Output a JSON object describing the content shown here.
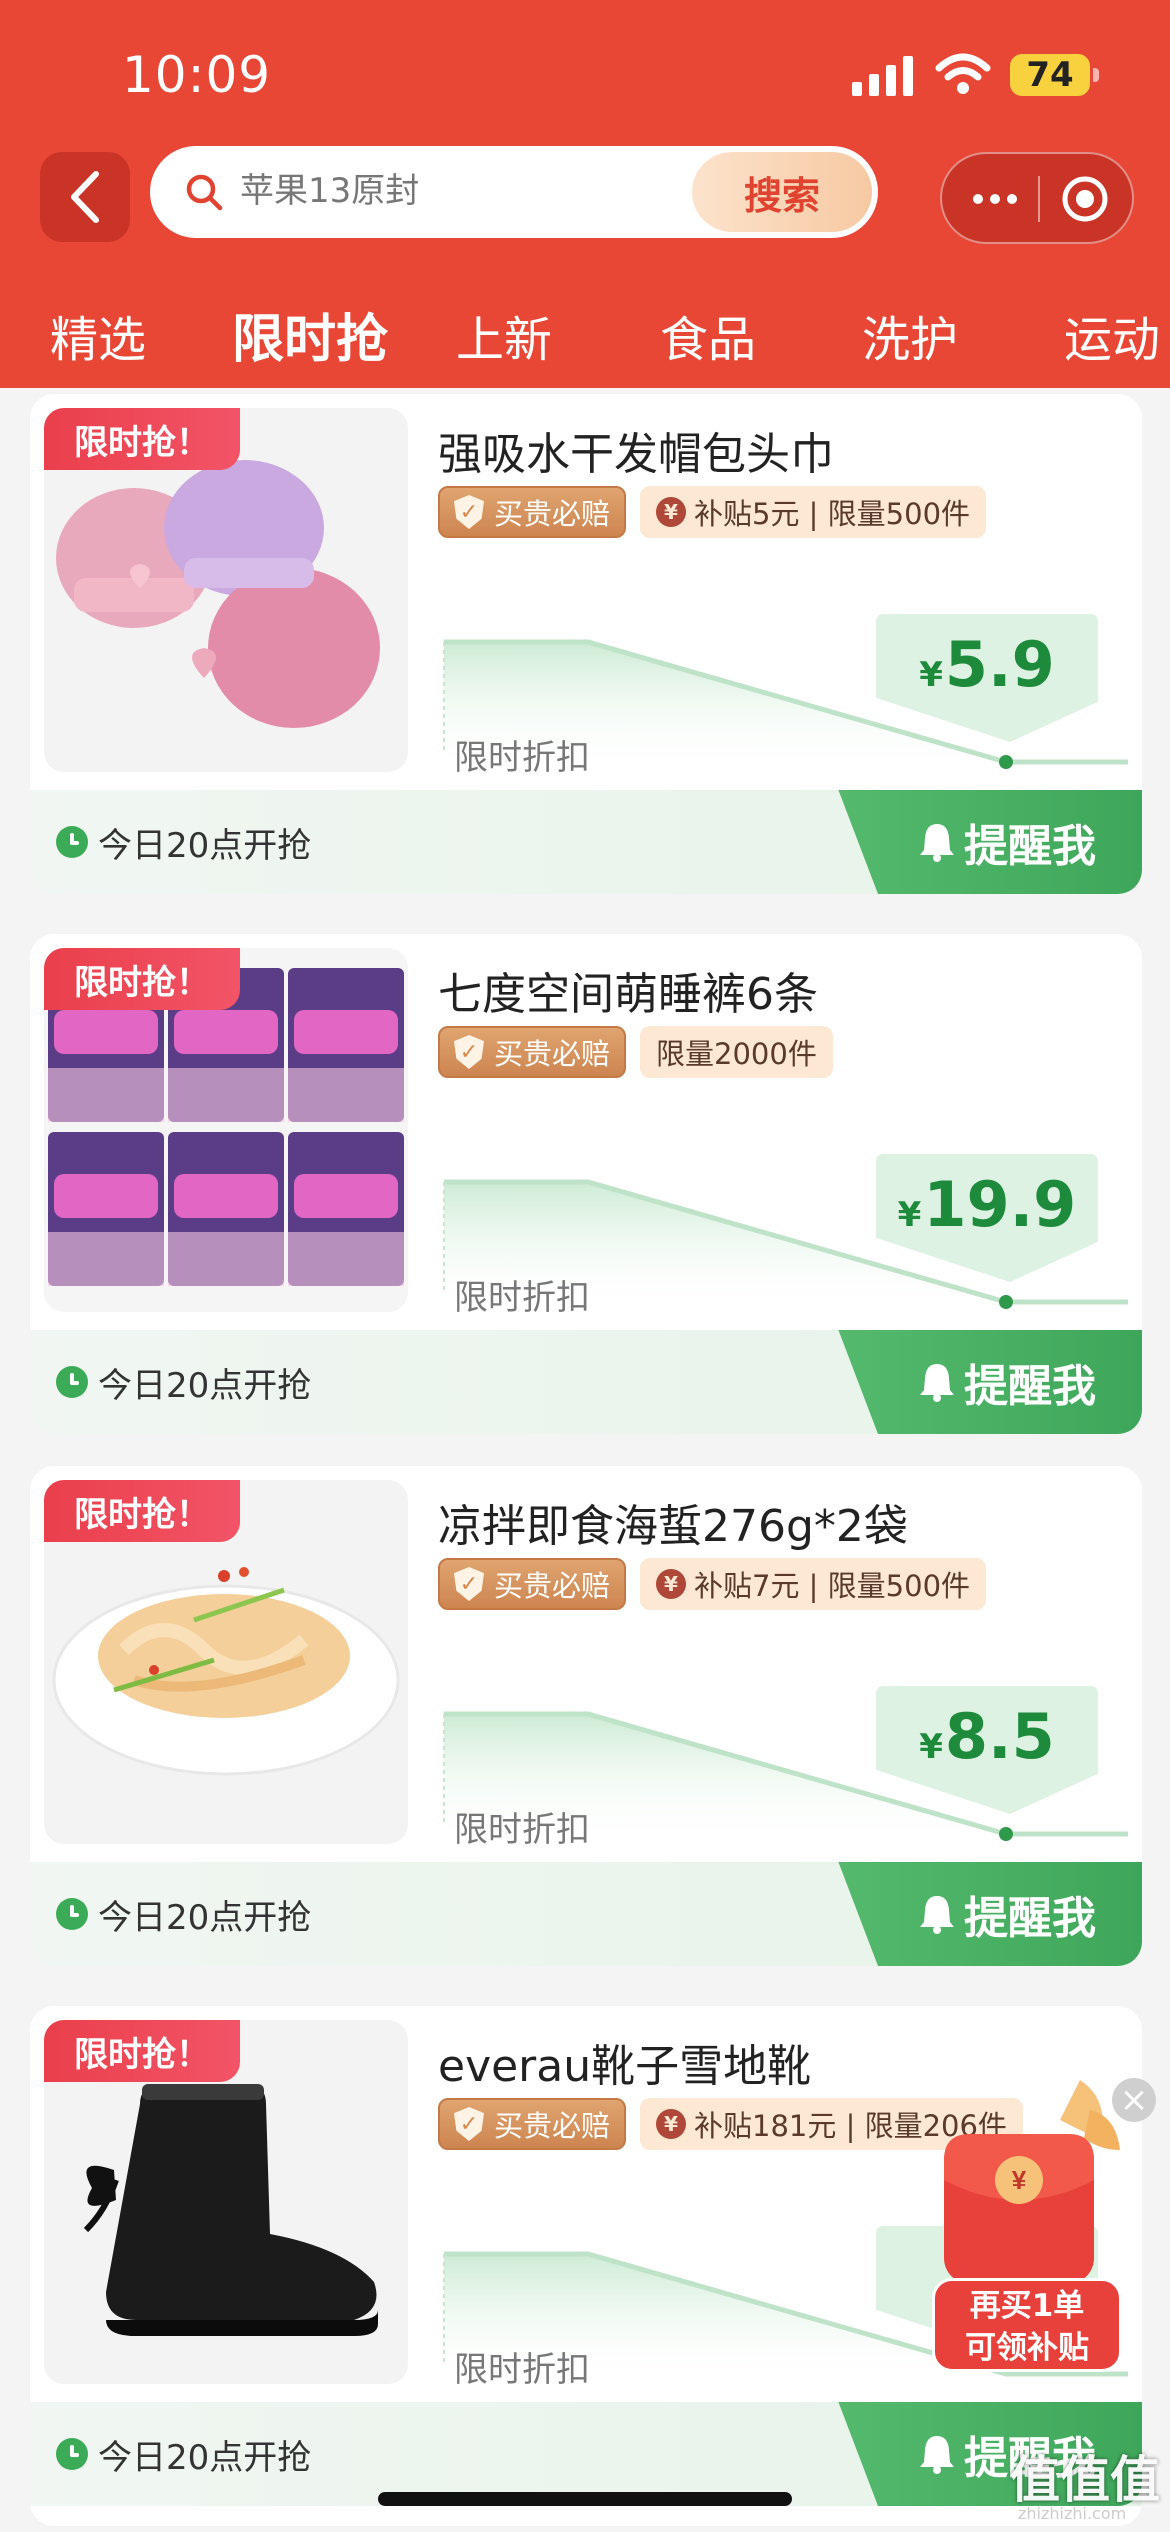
{
  "status_bar": {
    "time": "10:09",
    "battery": "74"
  },
  "search": {
    "placeholder": "苹果13原封",
    "button_label": "搜索"
  },
  "tabs": [
    "精选",
    "限时抢",
    "上新",
    "食品",
    "洗护",
    "运动"
  ],
  "active_tab": "限时抢",
  "products": [
    {
      "badge": "限时抢！",
      "title": "强吸水干发帽包头巾",
      "guarantee": "买贵必赔",
      "info": "补贴5元 | 限量500件",
      "has_subsidy": true,
      "chart_label": "限时折扣",
      "currency": "¥",
      "price": "5.9",
      "start_text": "今日20点开抢",
      "remind_label": "提醒我",
      "image_icon": "hair-cap-image"
    },
    {
      "badge": "限时抢！",
      "title": "七度空间萌睡裤6条",
      "guarantee": "买贵必赔",
      "info": "限量2000件",
      "has_subsidy": false,
      "chart_label": "限时折扣",
      "currency": "¥",
      "price": "19.9",
      "start_text": "今日20点开抢",
      "remind_label": "提醒我",
      "image_icon": "sleep-pants-pack-image"
    },
    {
      "badge": "限时抢！",
      "title": "凉拌即食海蜇276g*2袋",
      "guarantee": "买贵必赔",
      "info": "补贴7元 | 限量500件",
      "has_subsidy": true,
      "chart_label": "限时折扣",
      "currency": "¥",
      "price": "8.5",
      "start_text": "今日20点开抢",
      "remind_label": "提醒我",
      "image_icon": "jellyfish-dish-image"
    },
    {
      "badge": "限时抢！",
      "title": "everau靴子雪地靴",
      "guarantee": "买贵必赔",
      "info": "补贴181元 | 限量206件",
      "has_subsidy": true,
      "chart_label": "限时折扣",
      "currency": "¥",
      "price": "",
      "start_text": "今日20点开抢",
      "remind_label": "提醒我",
      "image_icon": "snow-boot-image"
    }
  ],
  "promo": {
    "line1": "再买1单",
    "line2": "可领补贴",
    "close": "×"
  },
  "watermark": {
    "main": "值值值",
    "sub": "zhizhizhi.com"
  },
  "colors": {
    "header": "#e94736",
    "price_green": "#1e8a3c",
    "remind_green": "#3ea65a",
    "badge_red": "#ea3f4c"
  }
}
